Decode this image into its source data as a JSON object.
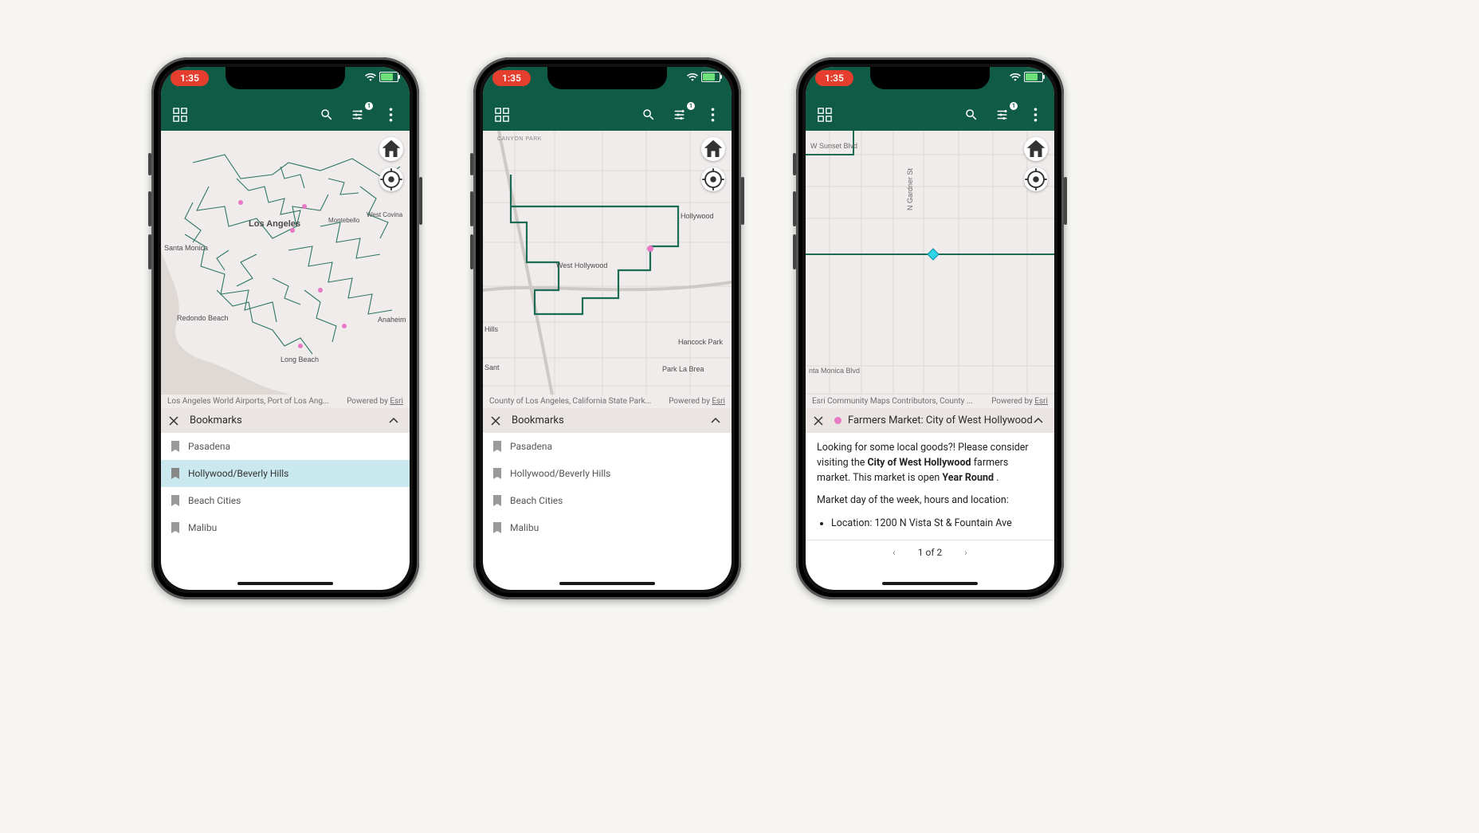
{
  "status": {
    "time": "1:35"
  },
  "header": {
    "filter_badge": "1"
  },
  "map_buttons": {
    "home": "home-icon",
    "locate": "locate-icon"
  },
  "attribution": {
    "powered_label": "Powered by",
    "powered_brand": "Esri",
    "phone1": "Los Angeles World Airports, Port of Los Ang...",
    "phone2": "County of Los Angeles, California State Park...",
    "phone3": "Esri Community Maps Contributors, County ..."
  },
  "bookmarks": {
    "title": "Bookmarks",
    "items": [
      "Pasadena",
      "Hollywood/Beverly Hills",
      "Beach Cities",
      "Malibu"
    ],
    "selected_index_phone1": 1,
    "selected_index_phone2": -1
  },
  "map_labels": {
    "phone1": [
      "Los Angeles",
      "Santa Monica",
      "Redondo Beach",
      "Long Beach",
      "Anaheim",
      "Montebello",
      "West Covina"
    ],
    "phone2": [
      "CANYON PARK",
      "West Hollywood",
      "Hollywood",
      "Hancock Park",
      "Park La Brea",
      "Hills",
      "Sant"
    ],
    "phone3": [
      "W Sunset Blvd",
      "N Gardner St",
      "nta Monica Blvd"
    ]
  },
  "detail": {
    "title": "Farmers Market: City of West Hollywood",
    "intro_pre": "Looking for some local goods?! Please consider visiting the ",
    "intro_bold1": "City of West Hollywood",
    "intro_post1": " farmers market. This market is open ",
    "intro_bold2": "Year Round",
    "intro_post2": " .",
    "subhead": "Market day of the week, hours and location:",
    "bullet1_label": "Location: ",
    "bullet1_value": "1200 N Vista St & Fountain Ave",
    "pager": {
      "label": "1 of 2"
    }
  }
}
